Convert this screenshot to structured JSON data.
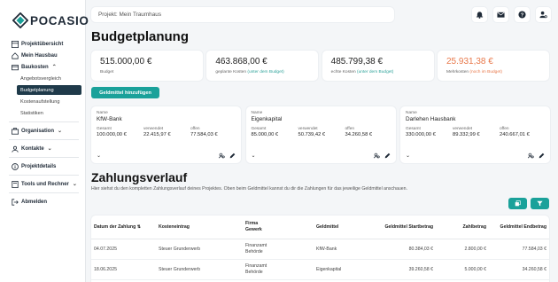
{
  "app": {
    "logo_text": "POCASIO"
  },
  "search": {
    "text": "Projekt: Mein Traumhaus"
  },
  "sidebar": {
    "items": [
      {
        "label": "Projektübersicht"
      },
      {
        "label": "Mein Hausbau"
      },
      {
        "label": "Baukosten"
      },
      {
        "label": "Organisation"
      },
      {
        "label": "Kontakte"
      },
      {
        "label": "Projektdetails"
      },
      {
        "label": "Tools und Rechner"
      },
      {
        "label": "Abmelden"
      }
    ],
    "subitems": [
      "Angebotsvergleich",
      "Budgetplanung",
      "Kostenaufstellung",
      "Statistiken"
    ]
  },
  "page_title": "Budgetplanung",
  "summary": [
    {
      "value": "515.000,00 €",
      "label": "Budget",
      "highlight": ""
    },
    {
      "value": "463.868,00 €",
      "label": "geplante Kosten",
      "highlight": "(unter dem Budget)"
    },
    {
      "value": "485.799,38 €",
      "label": "echte Kosten",
      "highlight": "(unter dem Budget)"
    },
    {
      "value": "25.931,38 €",
      "label": "Mehrkosten",
      "highlight": "(noch im Budget)"
    }
  ],
  "add_button": "Geldmittel hinzufügen",
  "funds_labels": {
    "name": "Name",
    "total": "Gesamt",
    "used": "verwendet",
    "open": "offen"
  },
  "funds": [
    {
      "name": "KfW-Bank",
      "total": "100.000,00 €",
      "used": "22.415,97 €",
      "open": "77.584,03 €"
    },
    {
      "name": "Eigenkapital",
      "total": "85.000,00 €",
      "used": "50.739,42 €",
      "open": "34.260,58 €"
    },
    {
      "name": "Darlehen Hausbank",
      "total": "330.000,00 €",
      "used": "89.332,99 €",
      "open": "240.667,01 €"
    }
  ],
  "section": {
    "title": "Zahlungsverlauf",
    "description": "Hier siehst du den kompletten Zahlungsverlauf deines Projektes. Oben beim Geldmittel kannst du dir die Zahlungen für das jeweilige Geldmittel anschauen."
  },
  "table": {
    "headers": [
      "Datum der Zahlung",
      "Kosteneintrag",
      "Firma",
      "Gewerk",
      "Geldmittel",
      "Geldmittel Startbetrag",
      "Zahlbetrag",
      "Geldmittel Endbetrag"
    ],
    "sort_icon": "⇅",
    "rows": [
      {
        "date": "04.07.2025",
        "entry": "Steuer Grunderwerb",
        "firma": "Finanzamt",
        "gewerk": "Behörde",
        "fund": "KfW-Bank",
        "start": "80.384,03 €",
        "amount": "2.800,00 €",
        "end": "77.584,03 €"
      },
      {
        "date": "18.06.2025",
        "entry": "Steuer Grunderwerb",
        "firma": "Finanzamt",
        "gewerk": "Behörde",
        "fund": "Eigenkapital",
        "start": "39.260,58 €",
        "amount": "5.000,00 €",
        "end": "34.260,58 €"
      }
    ]
  },
  "colors": {
    "accent": "#1aa19a",
    "active_nav": "#1f3a4a",
    "warning": "#e8784a",
    "positive": "#2ea39a"
  }
}
